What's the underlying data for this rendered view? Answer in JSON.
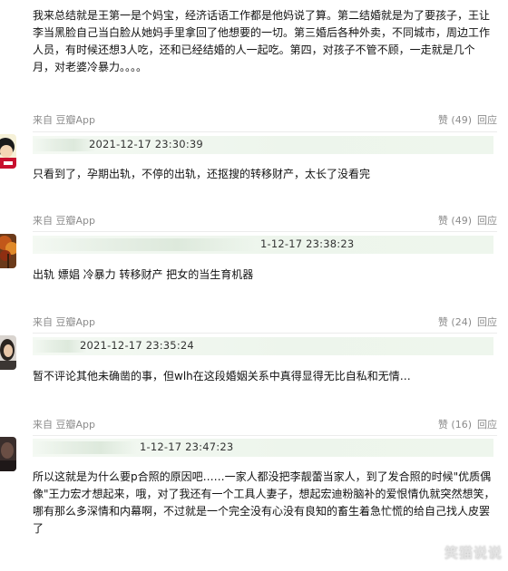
{
  "comments": [
    {
      "body": "我来总结就是王第一是个妈宝，经济话语工作都是他妈说了算。第二结婚就是为了要孩子，王让李当黑脸自己当白脸从她妈手里拿回了他想要的一切。第三婚后各种外卖，不同城市，周边工作人员，有时候还想3人吃，还和已经结婚的人一起吃。第四，对孩子不管不顾，一走就是几个月，对老婆冷暴力。。。。",
      "source": "来自 豆瓣App",
      "likes": "赞 (49)",
      "reply": "回应"
    },
    {
      "timestamp": "2021-12-17 23:30:39",
      "body": "只看到了，孕期出轨，不停的出轨，还抠搜的转移财产，太长了没看完",
      "source": "来自 豆瓣App",
      "likes": "赞 (49)",
      "reply": "回应"
    },
    {
      "timestamp": "1-12-17 23:38:23",
      "body": "出轨 嫖娼 冷暴力 转移财产 把女的当生育机器",
      "source": "来自 豆瓣App",
      "likes": "赞 (24)",
      "reply": "回应"
    },
    {
      "timestamp": "2021-12-17 23:35:24",
      "body": "暂不评论其他未确凿的事，但wlh在这段婚姻关系中真得显得无比自私和无情…",
      "source": "来自 豆瓣App",
      "likes": "赞 (16)",
      "reply": "回应"
    },
    {
      "timestamp": "1-12-17 23:47:23",
      "body": "所以这就是为什么要p合照的原因吧……一家人都没把李靓蕾当家人，到了发合照的时候\"优质偶像\"王力宏才想起来，哦，对了我还有一个工具人妻子，想起宏迪粉脑补的爱恨情仇就突然想笑，哪有那么多深情和内幕啊，不过就是一个完全没有心没有良知的畜生着急忙慌的给自己找人皮罢了"
    }
  ],
  "watermark": "笑猫说说",
  "colors": {
    "meta_strip": "#eef6ed",
    "muted_text": "#8b8b8b",
    "divider": "#ececec"
  }
}
